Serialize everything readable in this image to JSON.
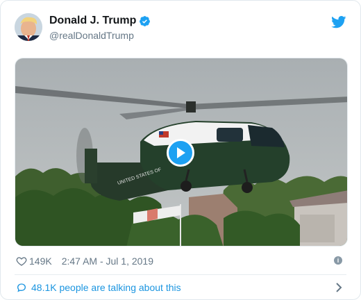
{
  "author": {
    "name": "Donald J. Trump",
    "handle": "@realDonaldTrump"
  },
  "media": {
    "type": "video",
    "description_icons": [
      "play-icon"
    ],
    "aircraft_marking": "UNITED STATES OF AMERICA"
  },
  "meta": {
    "likes": "149K",
    "timestamp": "2:47 AM - Jul 1, 2019"
  },
  "footer": {
    "talking_label": "48.1K people are talking about this"
  },
  "colors": {
    "accent": "#1da1f2",
    "link": "#1b95e0",
    "muted": "#657786",
    "border": "#e1e8ed"
  }
}
